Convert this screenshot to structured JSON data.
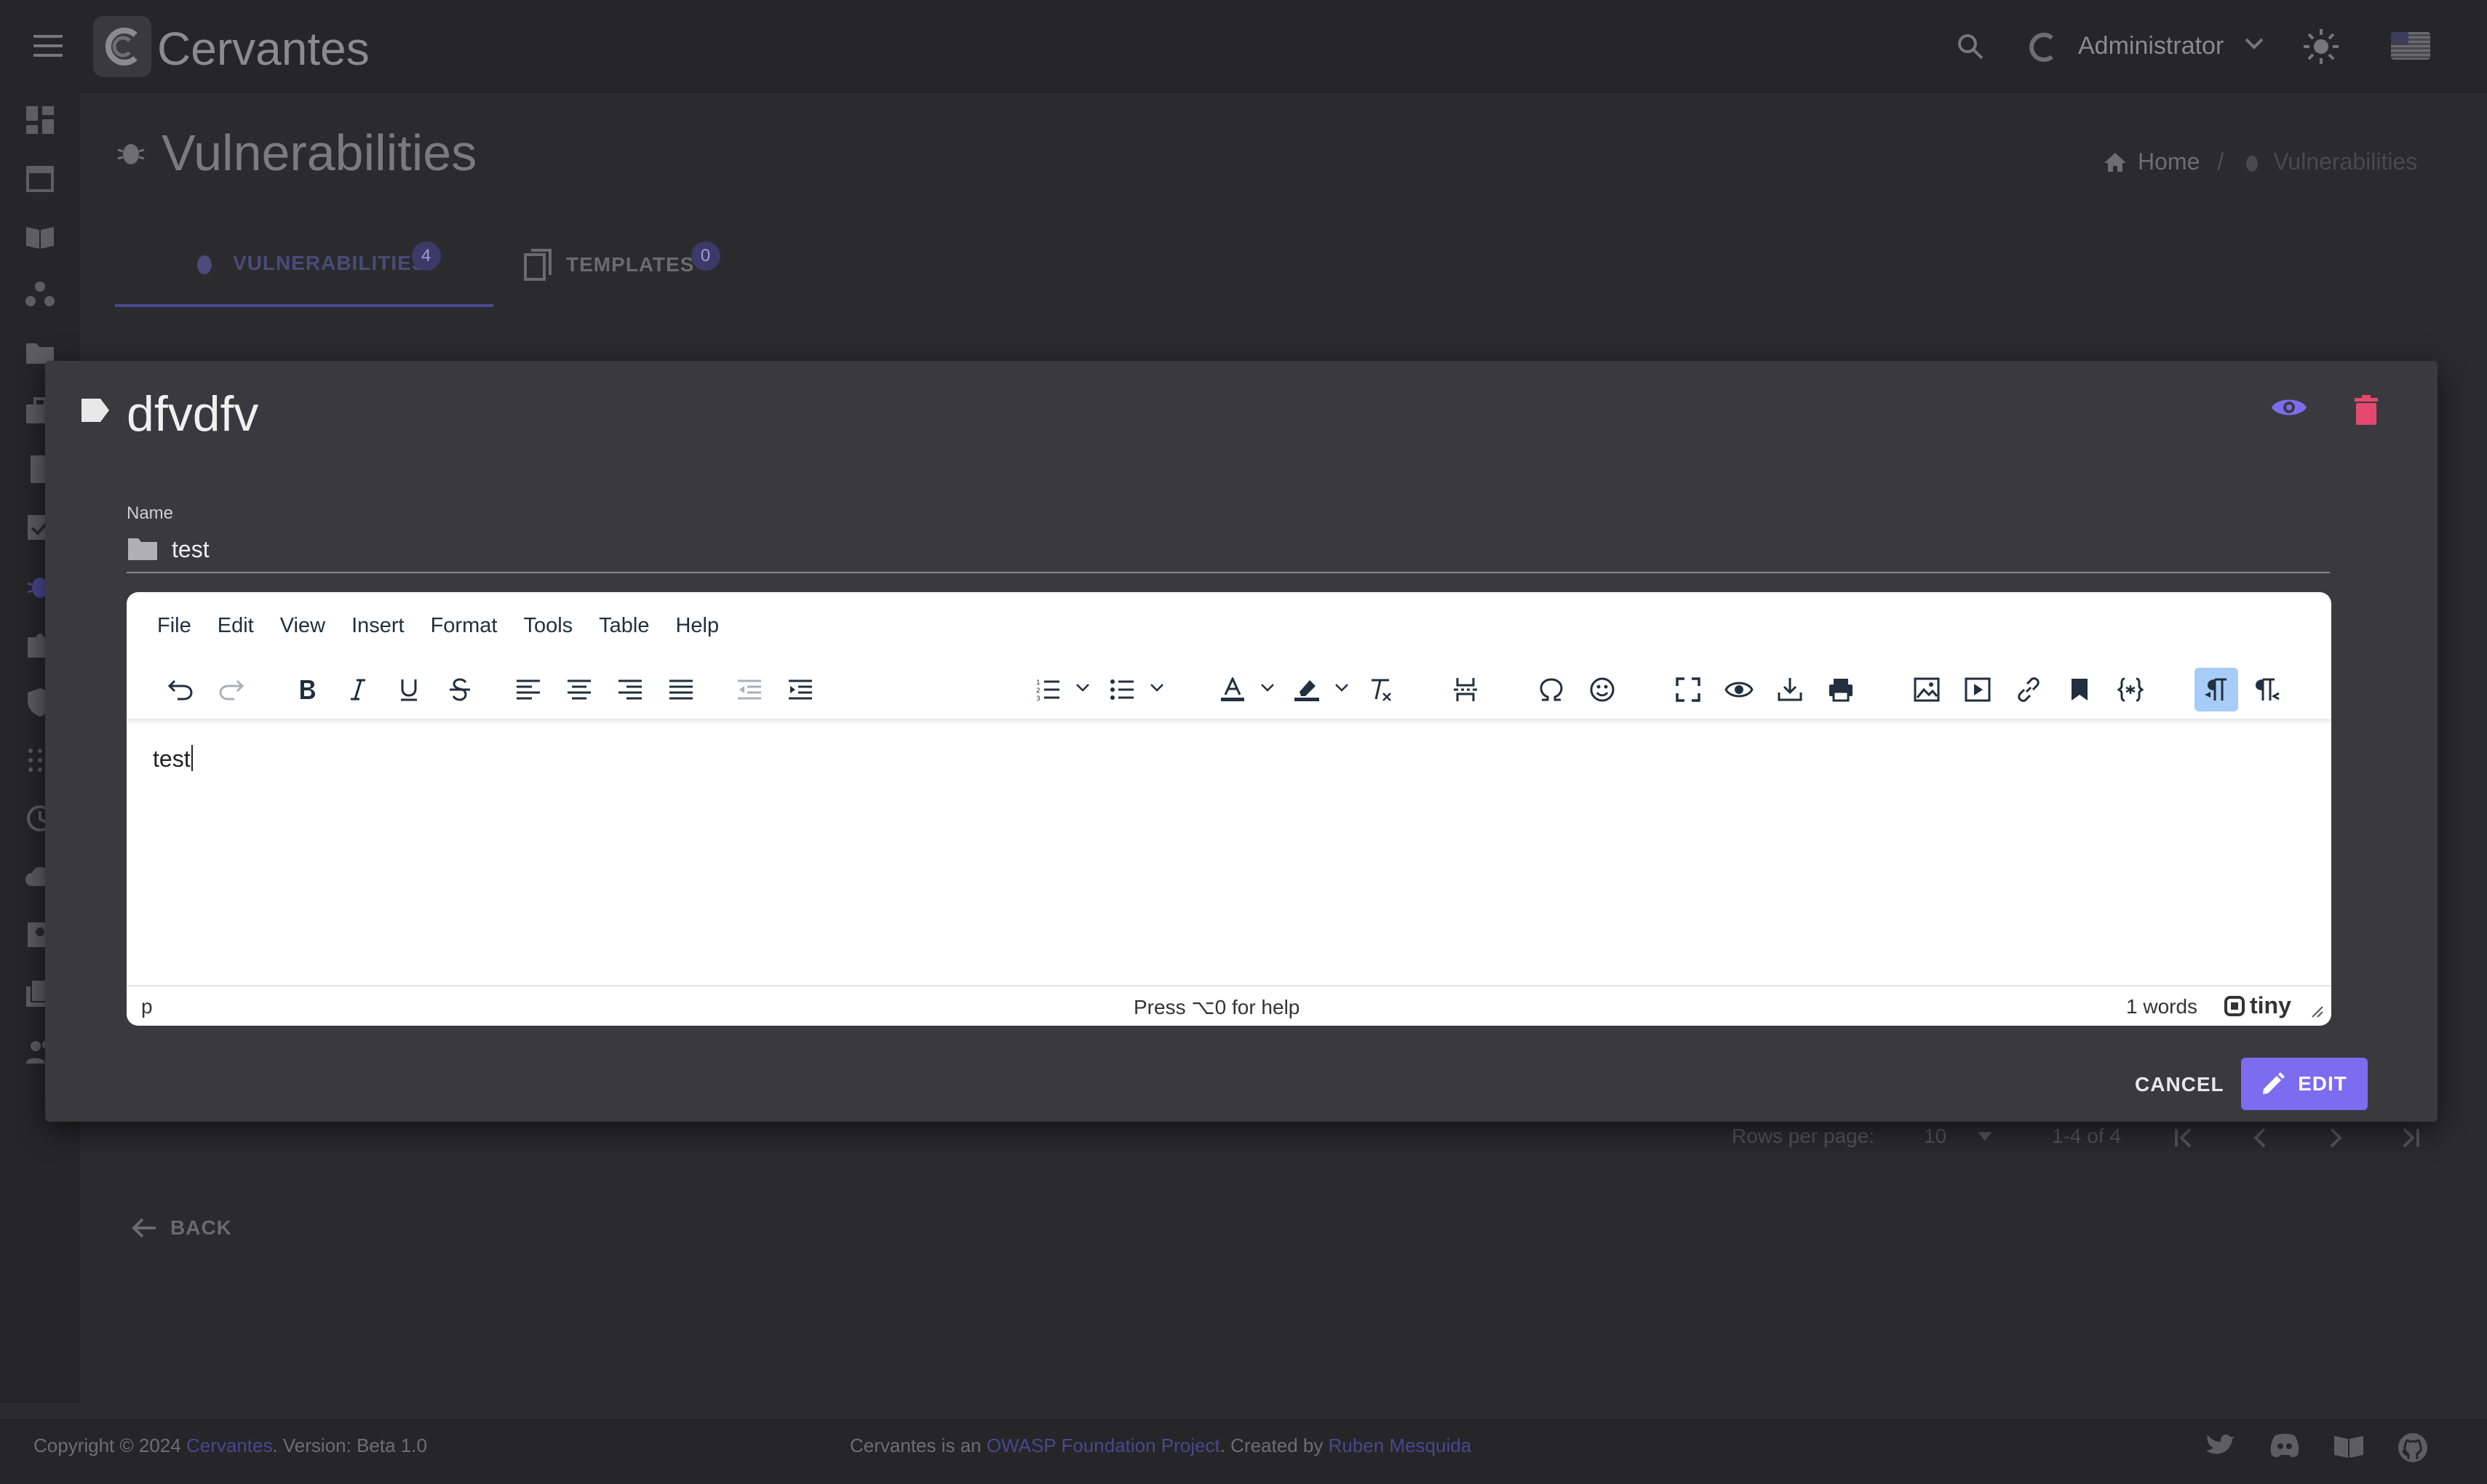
{
  "app": {
    "brand": "Cervantes"
  },
  "topbar": {
    "user_name": "Administrator"
  },
  "page": {
    "title": "Vulnerabilities"
  },
  "breadcrumb": {
    "home": "Home",
    "current": "Vulnerabilities"
  },
  "tabs": [
    {
      "label": "VULNERABILITIES",
      "count": "4"
    },
    {
      "label": "TEMPLATES",
      "count": "0"
    }
  ],
  "pager": {
    "rows_label": "Rows per page:",
    "rows_value": "10",
    "range": "1-4 of 4"
  },
  "back_label": "BACK",
  "modal": {
    "title": "dfvdfv",
    "name_label": "Name",
    "name_value": "test",
    "cancel_label": "CANCEL",
    "edit_label": "EDIT"
  },
  "editor": {
    "menu": [
      "File",
      "Edit",
      "View",
      "Insert",
      "Format",
      "Tools",
      "Table",
      "Help"
    ],
    "content": "test",
    "status_path": "p",
    "status_help": "Press ⌥0 for help",
    "word_count": "1 words",
    "brand": "tiny"
  },
  "footer": {
    "copyright_prefix": "Copyright © 2024",
    "copyright_link": "Cervantes",
    "version_text": ". Version:",
    "version_value": "Beta 1.0",
    "project_prefix": "Cervantes is an",
    "project_link": "OWASP Foundation Project",
    "created_prefix": ". Created by",
    "author": "Ruben Mesquida"
  },
  "colors": {
    "accent": "#7b6cf0",
    "danger": "#e5486e",
    "background": "#2b2b2e",
    "modal": "#3a3a3e"
  }
}
